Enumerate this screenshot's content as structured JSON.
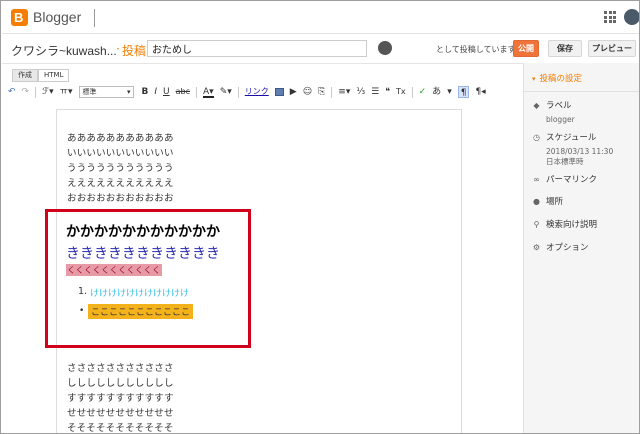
{
  "app": {
    "brand": "Blogger",
    "logo_letter": "B"
  },
  "titlerow": {
    "blog_name": "クワシラ~kuwash...",
    "separator": "·",
    "posts_label": "投稿",
    "title_value": "おためし",
    "posting_as": "として投稿しています",
    "publish": "公開",
    "save": "保存",
    "preview": "プレビュー"
  },
  "editor": {
    "tabs": [
      "作成",
      "HTML"
    ],
    "toolbar": {
      "undo": "↶",
      "redo": "↷",
      "font": "ℱ▾",
      "size": "ㅠ▾",
      "format": "標準",
      "bold": "B",
      "italic": "I",
      "underline": "U",
      "strike": "abc",
      "textcolor": "A▾",
      "highlight": "✎▾",
      "link": "リンク",
      "video": "▶",
      "emoji": "☺",
      "jump": "⎘",
      "align": "≡▾",
      "ol": "⅓",
      "ul": "☰",
      "quote": "❝",
      "clear": "Tx",
      "spell": "✓",
      "translit": "あ",
      "more": "▾",
      "ltr": "¶",
      "rtl": "¶◂"
    },
    "lines_top": [
      "あああああああああああ",
      "いいいいいいいいいいい",
      "ううううううううううう",
      "えええええええええええ",
      "おおおおおおおおおおお"
    ],
    "heading_black": "かかかかかかかかかかか",
    "heading_blue": "ききききききききききき",
    "ku_strip": "くくくくくくくくくくく",
    "ol_number": "1.",
    "ke_item": "けけけけけけけけけけけ",
    "ul_bullet": "•",
    "ko_item": "こここここここここここ",
    "lines_bottom": [
      "さささささささささささ",
      "ししししししししししし",
      "すすすすすすすすすすす",
      "せせせせせせせせせせせ",
      "そそそそそそそそそそそ"
    ]
  },
  "settings": {
    "header": "投稿の設定",
    "labels": "ラベル",
    "labels_value": "blogger",
    "schedule": "スケジュール",
    "schedule_date": "2018/03/13 11:30",
    "schedule_tz": "日本標準時",
    "permalink": "パーマリンク",
    "location": "場所",
    "search_desc": "検索向け説明",
    "options": "オプション"
  },
  "colors": {
    "accent": "#f57d00",
    "highlight_box": "#d0021b",
    "ke": "#3cc0e6",
    "ko_bg": "#f3b21c",
    "ku_bg": "#e59aa6",
    "blue": "#2b2bb4"
  },
  "icons": [
    "blogger-logo",
    "apps-grid-icon",
    "account-avatar",
    "label-icon",
    "clock-icon",
    "link-icon",
    "pin-icon",
    "search-icon",
    "gear-icon"
  ]
}
